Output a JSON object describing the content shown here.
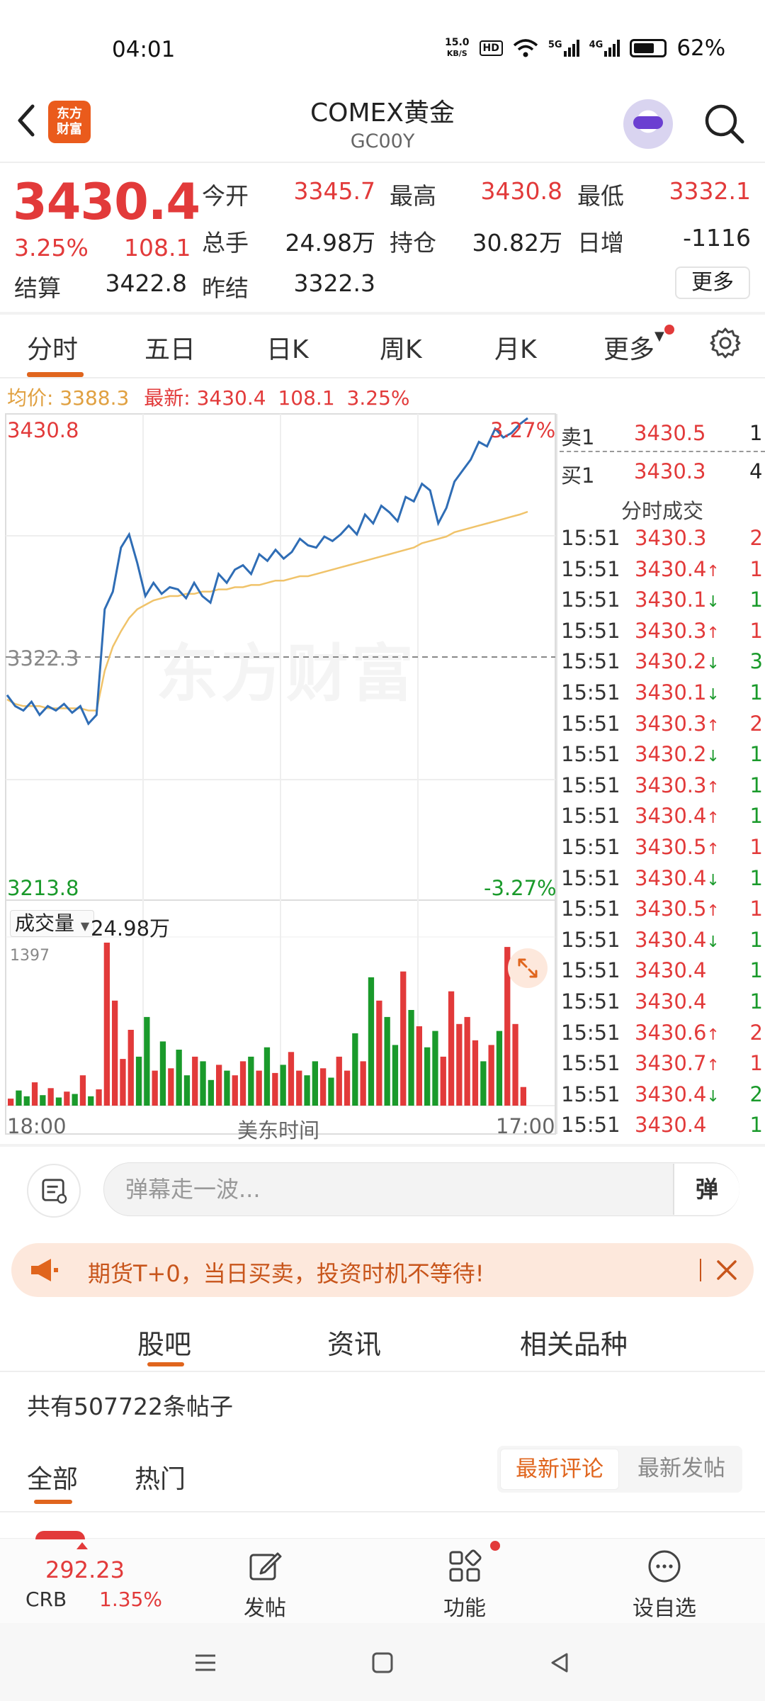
{
  "status_bar": {
    "time": "04:01",
    "net_speed_value": "15.0",
    "net_speed_unit": "KB/S",
    "hd_badge": "HD",
    "sig1_label": "5G",
    "sig2_label": "4G",
    "battery": "62%"
  },
  "header": {
    "logo_text_1": "东方",
    "logo_text_2": "财富",
    "title": "COMEX黄金",
    "code": "GC00Y"
  },
  "quote": {
    "price": "3430.4",
    "change_pct": "3.25%",
    "change_amt": "108.1",
    "open_label": "今开",
    "open": "3345.7",
    "high_label": "最高",
    "high": "3430.8",
    "low_label": "最低",
    "low": "3332.1",
    "volume_label": "总手",
    "volume": "24.98万",
    "oi_label": "持仓",
    "oi": "30.82万",
    "daily_inc_label": "日增",
    "daily_inc": "-1116",
    "settle_label": "结算",
    "settle": "3422.8",
    "prev_settle_label": "昨结",
    "prev_settle": "3322.3",
    "more_label": "更多"
  },
  "tabs": {
    "intraday": "分时",
    "five_day": "五日",
    "daily_k": "日K",
    "weekly_k": "周K",
    "monthly_k": "月K",
    "more": "更多"
  },
  "info_line": {
    "avg_label": "均价:",
    "avg_value": "3388.3",
    "latest_label": "最新:",
    "latest_price": "3430.4",
    "latest_change": "108.1",
    "latest_pct": "3.25%"
  },
  "chart": {
    "top_price": "3430.8",
    "top_pct": "3.27%",
    "mid_price": "3322.3",
    "bottom_price": "3213.8",
    "bottom_pct": "-3.27%",
    "watermark": "东方财富",
    "volume_selector": "成交量",
    "volume_total": "24.98万",
    "volume_max": "1397",
    "time_start": "18:00",
    "time_mid": "美东时间",
    "time_end": "17:00"
  },
  "chart_data": {
    "type": "line",
    "ylim": [
      3213.8,
      3430.8
    ],
    "reference_line": 3322.3,
    "series": [
      {
        "values": [
          3305,
          3300,
          3298,
          3302,
          3296,
          3300,
          3298,
          3301,
          3297,
          3300,
          3292,
          3296,
          3344,
          3352,
          3372,
          3378,
          3365,
          3350,
          3356,
          3351,
          3354,
          3353,
          3349,
          3356,
          3350,
          3347,
          3360,
          3356,
          3362,
          3364,
          3360,
          3369,
          3366,
          3371,
          3367,
          3370,
          3376,
          3373,
          3372,
          3377,
          3375,
          3378,
          3382,
          3378,
          3387,
          3383,
          3391,
          3388,
          3384,
          3395,
          3393,
          3401,
          3398,
          3383,
          3390,
          3402,
          3407,
          3412,
          3420,
          3418,
          3426,
          3422,
          3424,
          3428,
          3430.8
        ]
      },
      {
        "values": [
          3303,
          3301,
          3300,
          3300,
          3300,
          3299,
          3299,
          3299,
          3299,
          3299,
          3298,
          3298,
          3316,
          3327,
          3334,
          3340,
          3344,
          3346,
          3348,
          3349,
          3350,
          3350,
          3351,
          3351,
          3352,
          3352,
          3353,
          3353,
          3354,
          3354,
          3355,
          3355,
          3356,
          3357,
          3357,
          3358,
          3359,
          3359,
          3360,
          3361,
          3362,
          3363,
          3364,
          3365,
          3366,
          3367,
          3368,
          3369,
          3370,
          3371,
          3372,
          3374,
          3375,
          3376,
          3377,
          3379,
          3380,
          3381,
          3382,
          3383,
          3384,
          3385,
          3386,
          3387,
          3388.3
        ]
      }
    ],
    "volume": {
      "ylim": [
        0,
        1397
      ],
      "values": [
        60,
        130,
        80,
        200,
        90,
        150,
        70,
        120,
        100,
        260,
        80,
        140,
        1397,
        900,
        400,
        650,
        420,
        760,
        300,
        550,
        320,
        480,
        260,
        420,
        380,
        220,
        350,
        300,
        260,
        380,
        420,
        300,
        500,
        280,
        350,
        460,
        300,
        260,
        380,
        320,
        240,
        420,
        300,
        620,
        380,
        1100,
        900,
        760,
        520,
        1150,
        820,
        680,
        500,
        640,
        420,
        980,
        700,
        760,
        560,
        380,
        520,
        640,
        1360,
        700,
        160
      ]
    }
  },
  "order_book": {
    "sell_label": "卖1",
    "sell_price": "3430.5",
    "sell_vol": "1",
    "buy_label": "买1",
    "buy_price": "3430.3",
    "buy_vol": "4",
    "ticks_title": "分时成交",
    "ticks": [
      {
        "t": "15:51",
        "p": "3430.3",
        "d": "",
        "v": "2",
        "c": "red"
      },
      {
        "t": "15:51",
        "p": "3430.4",
        "d": "↑",
        "v": "1",
        "c": "red"
      },
      {
        "t": "15:51",
        "p": "3430.1",
        "d": "↓",
        "v": "1",
        "c": "green"
      },
      {
        "t": "15:51",
        "p": "3430.3",
        "d": "↑",
        "v": "1",
        "c": "red"
      },
      {
        "t": "15:51",
        "p": "3430.2",
        "d": "↓",
        "v": "3",
        "c": "green"
      },
      {
        "t": "15:51",
        "p": "3430.1",
        "d": "↓",
        "v": "1",
        "c": "green"
      },
      {
        "t": "15:51",
        "p": "3430.3",
        "d": "↑",
        "v": "2",
        "c": "red"
      },
      {
        "t": "15:51",
        "p": "3430.2",
        "d": "↓",
        "v": "1",
        "c": "green"
      },
      {
        "t": "15:51",
        "p": "3430.3",
        "d": "↑",
        "v": "1",
        "c": "green"
      },
      {
        "t": "15:51",
        "p": "3430.4",
        "d": "↑",
        "v": "1",
        "c": "green"
      },
      {
        "t": "15:51",
        "p": "3430.5",
        "d": "↑",
        "v": "1",
        "c": "red"
      },
      {
        "t": "15:51",
        "p": "3430.4",
        "d": "↓",
        "v": "1",
        "c": "green"
      },
      {
        "t": "15:51",
        "p": "3430.5",
        "d": "↑",
        "v": "1",
        "c": "red"
      },
      {
        "t": "15:51",
        "p": "3430.4",
        "d": "↓",
        "v": "1",
        "c": "green"
      },
      {
        "t": "15:51",
        "p": "3430.4",
        "d": "",
        "v": "1",
        "c": "green"
      },
      {
        "t": "15:51",
        "p": "3430.4",
        "d": "",
        "v": "1",
        "c": "green"
      },
      {
        "t": "15:51",
        "p": "3430.6",
        "d": "↑",
        "v": "2",
        "c": "red"
      },
      {
        "t": "15:51",
        "p": "3430.7",
        "d": "↑",
        "v": "1",
        "c": "red"
      },
      {
        "t": "15:51",
        "p": "3430.4",
        "d": "↓",
        "v": "2",
        "c": "green"
      },
      {
        "t": "15:51",
        "p": "3430.4",
        "d": "",
        "v": "1",
        "c": "green"
      }
    ]
  },
  "comment_bar": {
    "placeholder": "弹幕走一波...",
    "danmu_label": "弹"
  },
  "promo": {
    "text": "期货T+0，当日买卖，投资时机不等待!"
  },
  "sections": {
    "forum": "股吧",
    "news": "资讯",
    "related": "相关品种"
  },
  "feed": {
    "post_count": "共有507722条帖子",
    "tab_all": "全部",
    "tab_hot": "热门",
    "sort_latest_comment": "最新评论",
    "sort_latest_post": "最新发帖"
  },
  "toolbar": {
    "crb_value": "292.23",
    "crb_name": "CRB",
    "crb_pct": "1.35%",
    "post": "发帖",
    "functions": "功能",
    "add_watch": "设自选"
  },
  "colors": {
    "up": "#e23a3a",
    "down": "#1a9a2b",
    "accent": "#e0651d",
    "price_line": "#2f6db5",
    "avg_line": "#f0c36a"
  }
}
